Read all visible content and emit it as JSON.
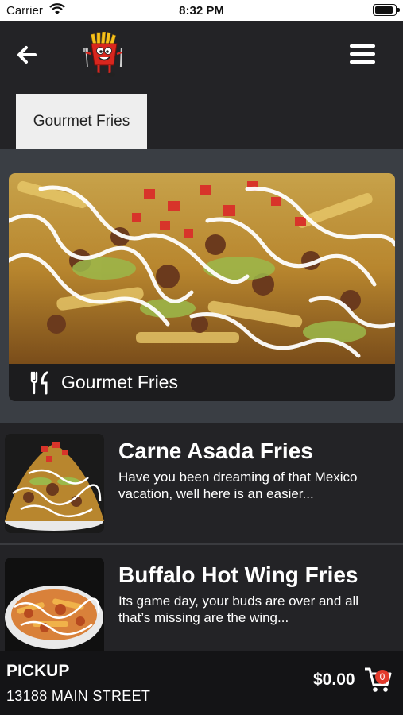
{
  "status_bar": {
    "carrier": "Carrier",
    "time": "8:32 PM"
  },
  "nav": {
    "back_icon": "arrow-left-icon",
    "logo": "fries-mascot-logo",
    "menu_icon": "hamburger-menu-icon"
  },
  "tabs": [
    {
      "label": "Gourmet Fries",
      "active": true
    }
  ],
  "hero": {
    "caption": "Gourmet Fries",
    "icon": "fork-knife-icon"
  },
  "menu_items": [
    {
      "title": "Carne Asada Fries",
      "description": "Have you been dreaming of that Mexico vacation, well here is an easier..."
    },
    {
      "title": "Buffalo Hot Wing Fries",
      "description": "Its game day, your buds are over and all that’s missing are the wing..."
    }
  ],
  "footer": {
    "mode": "PICKUP",
    "address": "13188 MAIN STREET",
    "total": "$0.00",
    "cart_count": "0"
  },
  "colors": {
    "background": "#232326",
    "hero_band": "#3a3e44",
    "footer": "#141416",
    "badge": "#e23a2c"
  }
}
